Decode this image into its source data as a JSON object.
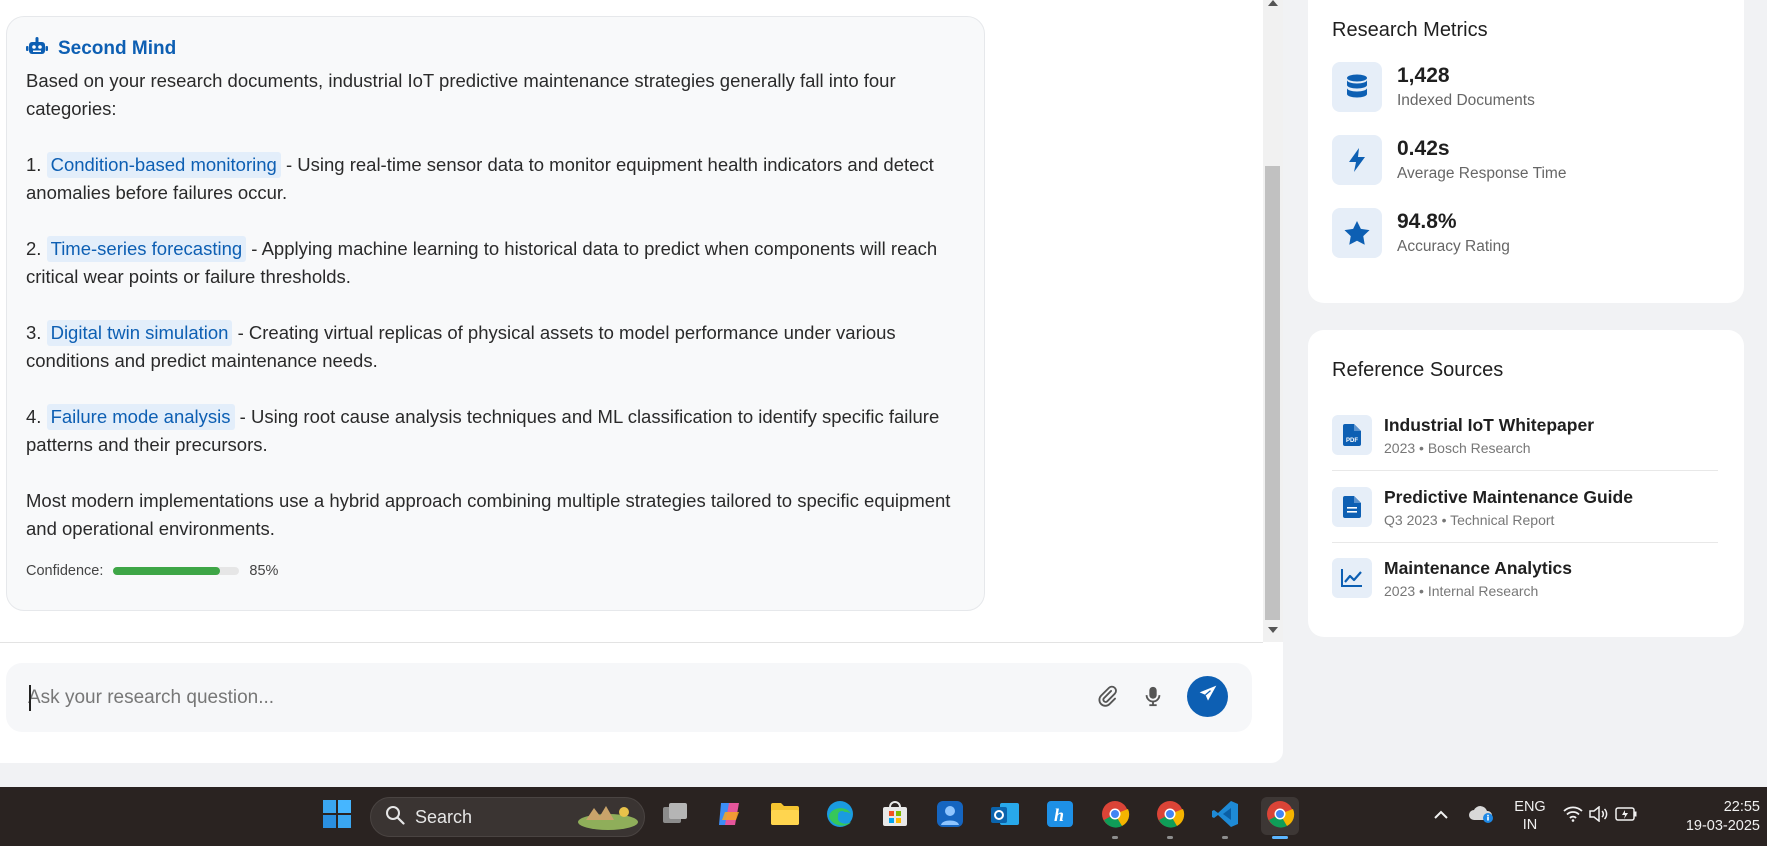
{
  "assistant": {
    "name": "Second Mind",
    "intro": "Based on your research documents, industrial IoT predictive maintenance strategies generally fall into four categories:",
    "strategies": [
      {
        "num": "1.",
        "term": "Condition-based monitoring",
        "desc": " - Using real-time sensor data to monitor equipment health indicators and detect anomalies before failures occur."
      },
      {
        "num": "2.",
        "term": "Time-series forecasting",
        "desc": " - Applying machine learning to historical data to predict when components will reach critical wear points or failure thresholds."
      },
      {
        "num": "3.",
        "term": "Digital twin simulation",
        "desc": " - Creating virtual replicas of physical assets to model performance under various conditions and predict maintenance needs."
      },
      {
        "num": "4.",
        "term": "Failure mode analysis",
        "desc": " - Using root cause analysis techniques and ML classification to identify specific failure patterns and their precursors."
      }
    ],
    "conclusion": "Most modern implementations use a hybrid approach combining multiple strategies tailored to specific equipment and operational environments.",
    "confidence_label": "Confidence:",
    "confidence_value": "85%",
    "confidence_fraction": 0.85
  },
  "input": {
    "placeholder": "Ask your research question..."
  },
  "metrics": {
    "title": "Research Metrics",
    "items": [
      {
        "icon": "database-icon",
        "value": "1,428",
        "label": "Indexed Documents"
      },
      {
        "icon": "bolt-icon",
        "value": "0.42s",
        "label": "Average Response Time"
      },
      {
        "icon": "star-icon",
        "value": "94.8%",
        "label": "Accuracy Rating"
      }
    ]
  },
  "sources": {
    "title": "Reference Sources",
    "items": [
      {
        "icon": "pdf-file-icon",
        "title": "Industrial IoT Whitepaper",
        "meta": "2023 • Bosch Research"
      },
      {
        "icon": "document-icon",
        "title": "Predictive Maintenance Guide",
        "meta": "Q3 2023 • Technical Report"
      },
      {
        "icon": "line-chart-icon",
        "title": "Maintenance Analytics",
        "meta": "2023 • Internal Research"
      }
    ]
  },
  "taskbar": {
    "search_label": "Search",
    "lang_line1": "ENG",
    "lang_line2": "IN",
    "time": "22:55",
    "date": "19-03-2025"
  },
  "colors": {
    "accent": "#0d5fb3",
    "chip_bg": "#e3eefa",
    "confidence_bar": "#3ea646",
    "taskbar_bg": "#2a2321"
  }
}
